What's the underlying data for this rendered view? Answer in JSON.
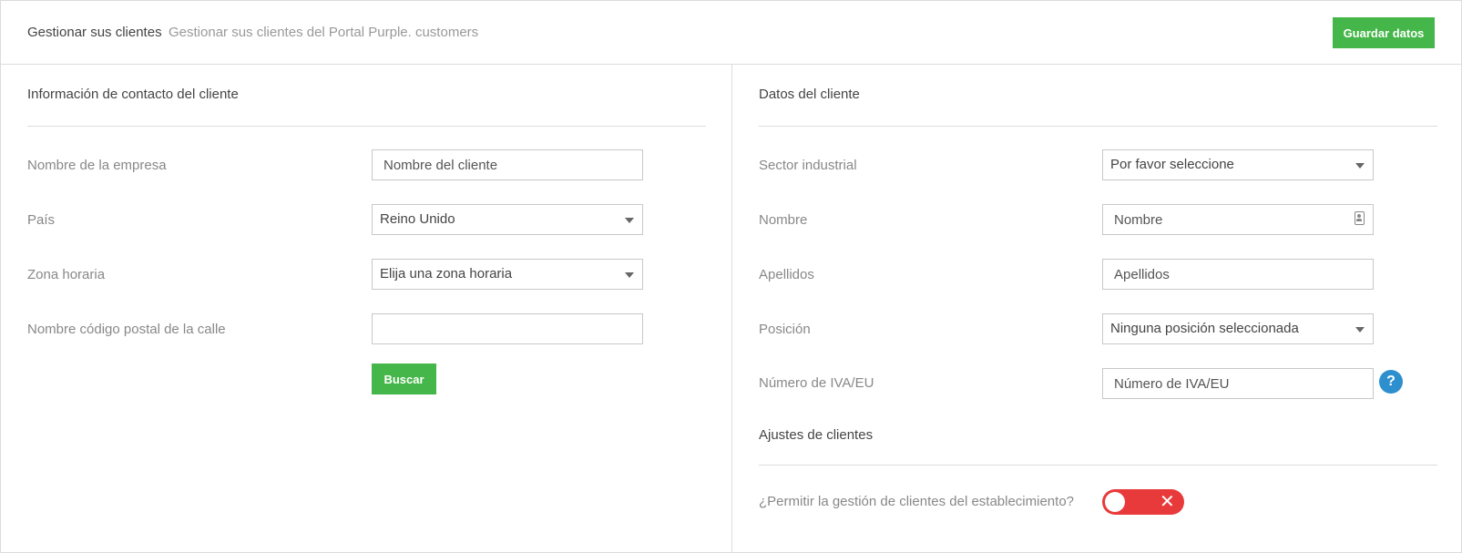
{
  "header": {
    "title": "Gestionar sus clientes",
    "subtitle": "Gestionar sus clientes del Portal Purple. customers",
    "save_label": "Guardar datos"
  },
  "contact": {
    "title": "Información de contacto del cliente",
    "company_label": "Nombre de la empresa",
    "company_placeholder": "Nombre del cliente",
    "country_label": "País",
    "country_value": "Reino Unido",
    "timezone_label": "Zona horaria",
    "timezone_value": "Elija una zona horaria",
    "street_label": "Nombre código postal de la calle",
    "street_value": "",
    "search_label": "Buscar"
  },
  "client": {
    "title": "Datos del cliente",
    "industry_label": "Sector industrial",
    "industry_value": "Por favor seleccione",
    "first_name_label": "Nombre",
    "first_name_placeholder": "Nombre",
    "last_name_label": "Apellidos",
    "last_name_placeholder": "Apellidos",
    "position_label": "Posición",
    "position_value": "Ninguna posición seleccionada",
    "vat_label": "Número de IVA/EU",
    "vat_placeholder": "Número de IVA/EU",
    "help_glyph": "?"
  },
  "settings": {
    "title": "Ajustes de clientes",
    "allow_label": "¿Permitir la gestión de clientes del establecimiento?",
    "allow_state": "off",
    "toggle_glyph": "✕",
    "toggle_color": "#e83a3a"
  },
  "colors": {
    "accent_green": "#45b649",
    "help_blue": "#2d8fce"
  }
}
